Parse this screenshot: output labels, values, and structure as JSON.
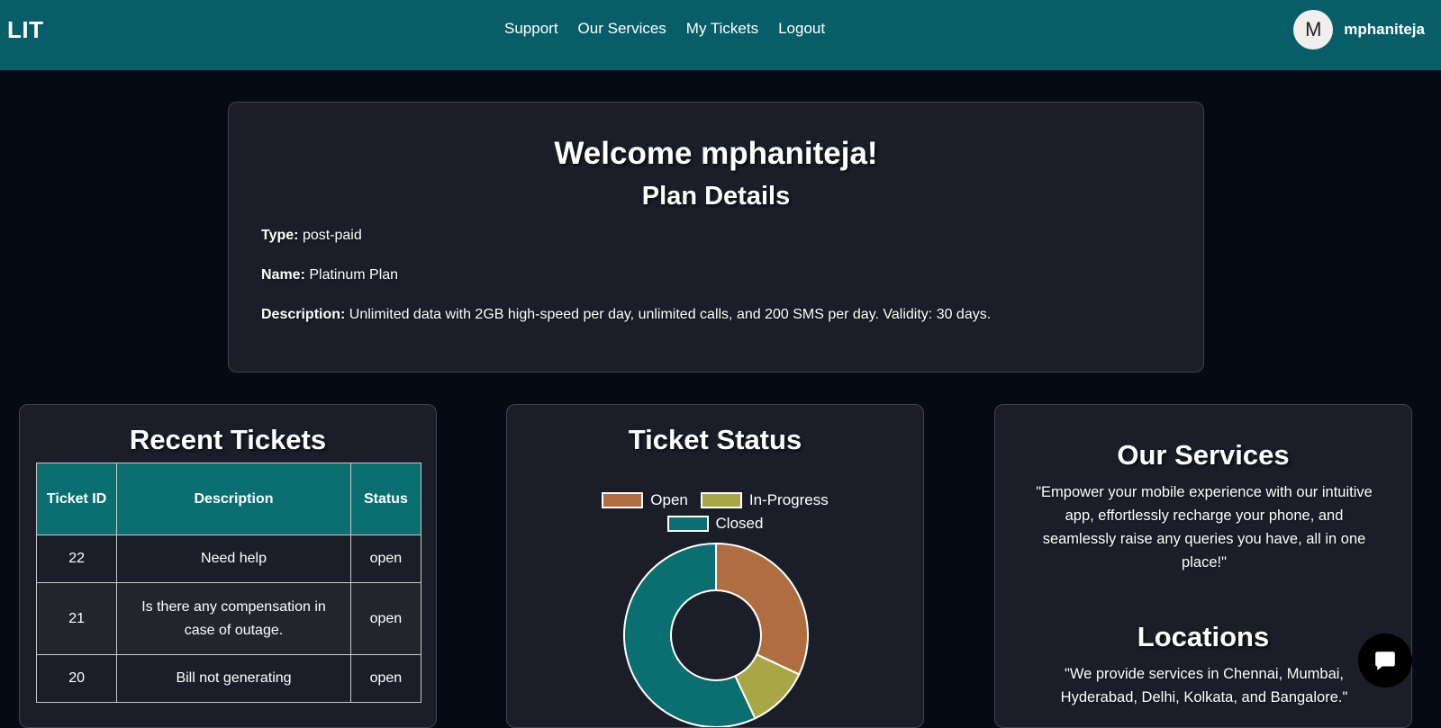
{
  "navbar": {
    "brand": "LIT",
    "links": [
      "Support",
      "Our Services",
      "My Tickets",
      "Logout"
    ],
    "avatar_initial": "M",
    "username": "mphaniteja"
  },
  "welcome": {
    "title": "Welcome mphaniteja!",
    "plan_heading": "Plan Details",
    "type_label": "Type:",
    "type_value": "post-paid",
    "name_label": "Name:",
    "name_value": "Platinum Plan",
    "description_label": "Description:",
    "description_value": "Unlimited data with 2GB high-speed per day, unlimited calls, and 200 SMS per day. Validity: 30 days."
  },
  "recent_tickets": {
    "title": "Recent Tickets",
    "columns": [
      "Ticket ID",
      "Description",
      "Status"
    ],
    "rows": [
      {
        "id": "22",
        "description": "Need help",
        "status": "open"
      },
      {
        "id": "21",
        "description": "Is there any compensation in case of outage.",
        "status": "open"
      },
      {
        "id": "20",
        "description": "Bill not generating",
        "status": "open"
      }
    ]
  },
  "ticket_status": {
    "title": "Ticket Status"
  },
  "chart_data": {
    "type": "pie",
    "variant": "doughnut",
    "legend_position": "top",
    "series": [
      {
        "name": "Open",
        "value": 32,
        "color": "#b06e40"
      },
      {
        "name": "In-Progress",
        "value": 11,
        "color": "#a9a745"
      },
      {
        "name": "Closed",
        "value": 57,
        "color": "#0b6e70"
      }
    ]
  },
  "services": {
    "title": "Our Services",
    "text": "\"Empower your mobile experience with our intuitive app, effortlessly recharge your phone, and seamlessly raise any queries you have, all in one place!\"",
    "locations_title": "Locations",
    "locations_text": "\"We provide services in Chennai, Mumbai, Hyderabad, Delhi, Kolkata, and Bangalore.\""
  },
  "chat": {
    "icon": "chat-bubble-icon"
  }
}
